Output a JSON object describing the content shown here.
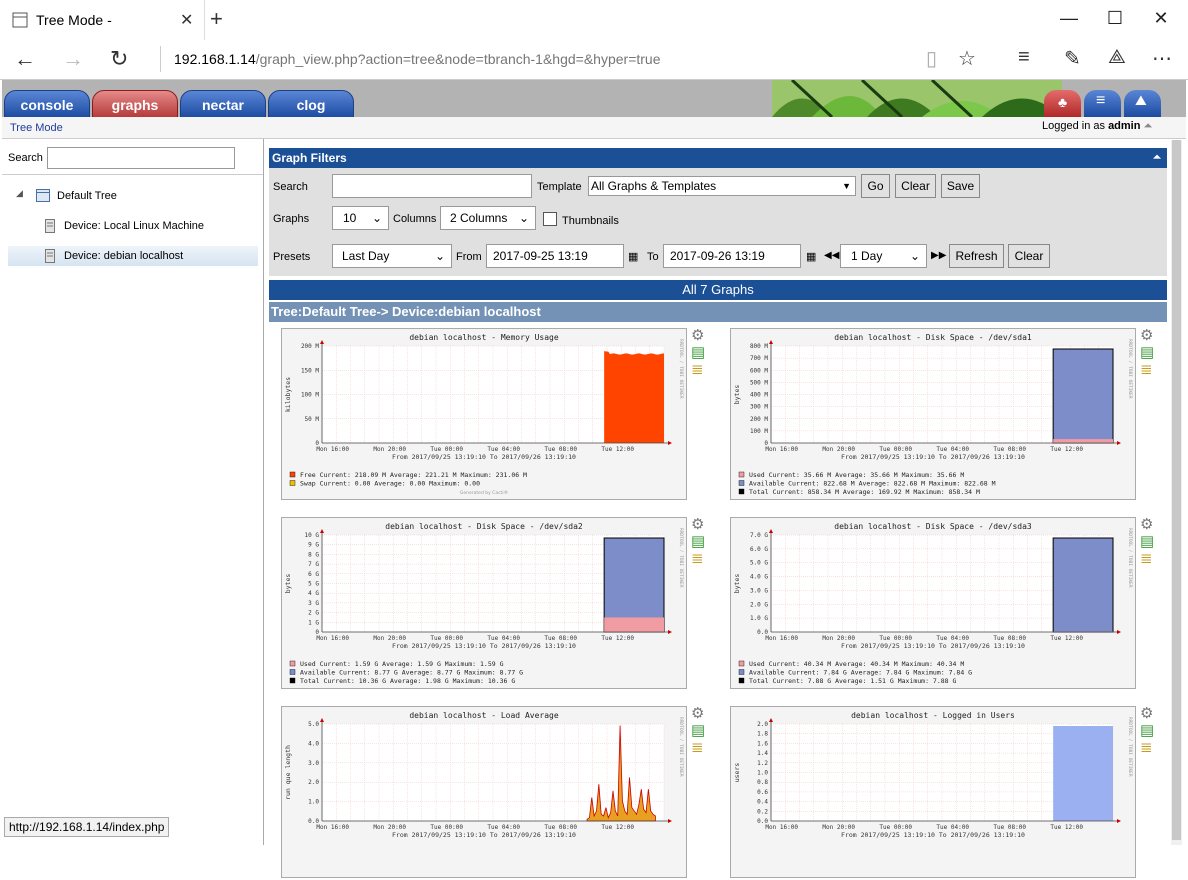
{
  "browser": {
    "tab_title": "Tree Mode -",
    "url_host": "192.168.1.14",
    "url_path": "/graph_view.php?action=tree&node=tbranch-1&hgd=&hyper=true",
    "status_url": "http://192.168.1.14/index.php"
  },
  "cacti": {
    "tabs": [
      "console",
      "graphs",
      "nectar",
      "clog"
    ],
    "breadcrumb": "Tree Mode",
    "logged_in_prefix": "Logged in as",
    "user": "admin"
  },
  "tree": {
    "search_label": "Search",
    "root": "Default Tree",
    "devices": [
      "Device: Local Linux Machine",
      "Device: debian localhost"
    ]
  },
  "filters": {
    "title": "Graph Filters",
    "search_label": "Search",
    "template_label": "Template",
    "template_value": "All Graphs & Templates",
    "go": "Go",
    "clear": "Clear",
    "save": "Save",
    "graphs_label": "Graphs",
    "graphs_value": "10",
    "columns_label": "Columns",
    "columns_value": "2 Columns",
    "thumbnails_label": "Thumbnails",
    "presets_label": "Presets",
    "presets_value": "Last Day",
    "from_label": "From",
    "from_value": "2017-09-25 13:19",
    "to_label": "To",
    "to_value": "2017-09-26 13:19",
    "span_value": "1 Day",
    "refresh": "Refresh",
    "clear2": "Clear"
  },
  "summary": "All 7 Graphs",
  "tree_header": "Tree:Default Tree-> Device:debian localhost",
  "graphs": [
    {
      "title": "debian localhost - Memory Usage",
      "ylabel": "kilobytes",
      "yticks": [
        "200 M",
        "150 M",
        "100 M",
        "50 M",
        "0"
      ],
      "legend": [
        "Free    Current:   218.09 M    Average:   221.21 M    Maximum:   231.06 M",
        "Swap    Current:     0.00      Average:     0.00      Maximum:     0.00"
      ]
    },
    {
      "title": "debian localhost - Disk Space - /dev/sda1",
      "ylabel": "bytes",
      "yticks": [
        "800 M",
        "700 M",
        "600 M",
        "500 M",
        "400 M",
        "300 M",
        "200 M",
        "100 M",
        "0"
      ],
      "legend": [
        "Used       Current:    35.66 M    Average:    35.66 M    Maximum:    35.66 M",
        "Available  Current:   822.68 M    Average:   822.68 M    Maximum:   822.68 M",
        "Total      Current:   858.34 M    Average:   169.92 M    Maximum:   858.34 M"
      ]
    },
    {
      "title": "debian localhost - Disk Space - /dev/sda2",
      "ylabel": "bytes",
      "yticks": [
        "10 G",
        "9 G",
        "8 G",
        "7 G",
        "6 G",
        "5 G",
        "4 G",
        "3 G",
        "2 G",
        "1 G",
        "0"
      ],
      "legend": [
        "Used       Current:     1.59 G    Average:     1.59 G    Maximum:     1.59 G",
        "Available  Current:     8.77 G    Average:     8.77 G    Maximum:     8.77 G",
        "Total      Current:    10.36 G    Average:     1.98 G    Maximum:    10.36 G"
      ]
    },
    {
      "title": "debian localhost - Disk Space - /dev/sda3",
      "ylabel": "bytes",
      "yticks": [
        "7.0 G",
        "6.0 G",
        "5.0 G",
        "4.0 G",
        "3.0 G",
        "2.0 G",
        "1.0 G",
        "0.0"
      ],
      "legend": [
        "Used       Current:    40.34 M    Average:    40.34 M    Maximum:    40.34 M",
        "Available  Current:     7.84 G    Average:     7.84 G    Maximum:     7.84 G",
        "Total      Current:     7.88 G    Average:     1.51 G    Maximum:     7.88 G"
      ]
    },
    {
      "title": "debian localhost - Load Average",
      "ylabel": "run que length",
      "yticks": [
        "5.0",
        "4.0",
        "3.0",
        "2.0",
        "1.0",
        "0.0"
      ],
      "legend": []
    },
    {
      "title": "debian localhost - Logged in Users",
      "ylabel": "users",
      "yticks": [
        "2.0",
        "1.8",
        "1.6",
        "1.4",
        "1.2",
        "1.0",
        "0.8",
        "0.6",
        "0.4",
        "0.2",
        "0.0"
      ],
      "legend": []
    }
  ],
  "xticks": [
    "Mon 16:00",
    "Mon 20:00",
    "Tue 00:00",
    "Tue 04:00",
    "Tue 08:00",
    "Tue 12:00"
  ],
  "range_text": "From 2017/09/25 13:19:10 To 2017/09/26 13:19:10",
  "generated": "Generated by Cacti®",
  "side_text": "RRDTOOL / TOBI OETIKER",
  "colors": {
    "memory": "#ff4400",
    "used": "#f19ca2",
    "available": "#7c8dc9",
    "users": "#9ab0f0",
    "load": "#e8a020"
  }
}
